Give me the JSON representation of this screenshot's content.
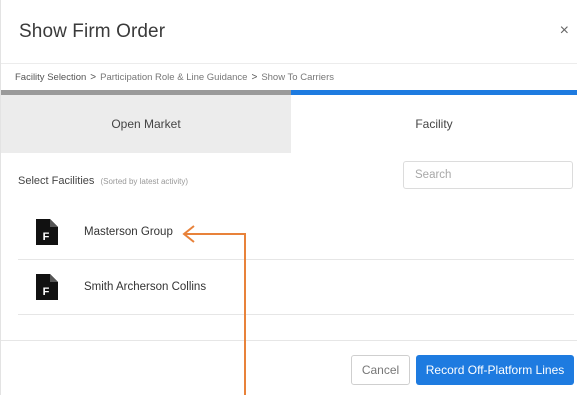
{
  "dialog": {
    "title": "Show Firm Order",
    "close_icon": "close-icon",
    "close_glyph": "×"
  },
  "breadcrumb": {
    "steps": [
      "Facility Selection",
      "Participation Role & Line Guidance",
      "Show To Carriers"
    ],
    "separator": ">"
  },
  "tabs": [
    {
      "label": "Open Market"
    },
    {
      "label": "Facility"
    }
  ],
  "facilities": {
    "label": "Select Facilities",
    "hint": "(Sorted by latest activity)",
    "search_placeholder": "Search",
    "items": [
      {
        "name": "Masterson Group",
        "icon": "facility-file-icon",
        "icon_letter": "F"
      },
      {
        "name": "Smith Archerson Collins",
        "icon": "facility-file-icon",
        "icon_letter": "F"
      }
    ]
  },
  "footer": {
    "cancel_label": "Cancel",
    "primary_label": "Record Off-Platform Lines"
  },
  "colors": {
    "accent": "#1e7be0",
    "annotation_arrow": "#e8823a"
  }
}
